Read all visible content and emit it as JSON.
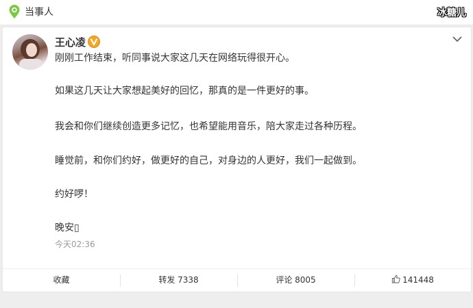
{
  "header": {
    "topic": "当事人",
    "watermark": "冰糖儿"
  },
  "post": {
    "username": "王心凌",
    "paragraphs": [
      "刚刚工作结束，听同事说大家这几天在网络玩得很开心。",
      "如果这几天让大家想起美好的回忆，那真的是一件更好的事。",
      "我会和你们继续创造更多记忆，也希望能用音乐，陪大家走过各种历程。",
      "睡觉前，和你们约好，做更好的自己，对身边的人更好，我们一起做到。",
      "约好啰！",
      "晚安▯"
    ],
    "timestamp": "今天02:36"
  },
  "actions": {
    "favorite": "收藏",
    "repost": "转发 7338",
    "comment": "评论 8005",
    "like": "141448"
  },
  "colors": {
    "accent": "#f5a623",
    "location_icon": "#7ac943"
  },
  "icons": [
    "location-pin-icon",
    "verified-badge-icon",
    "chevron-down-icon",
    "thumbs-up-icon"
  ]
}
